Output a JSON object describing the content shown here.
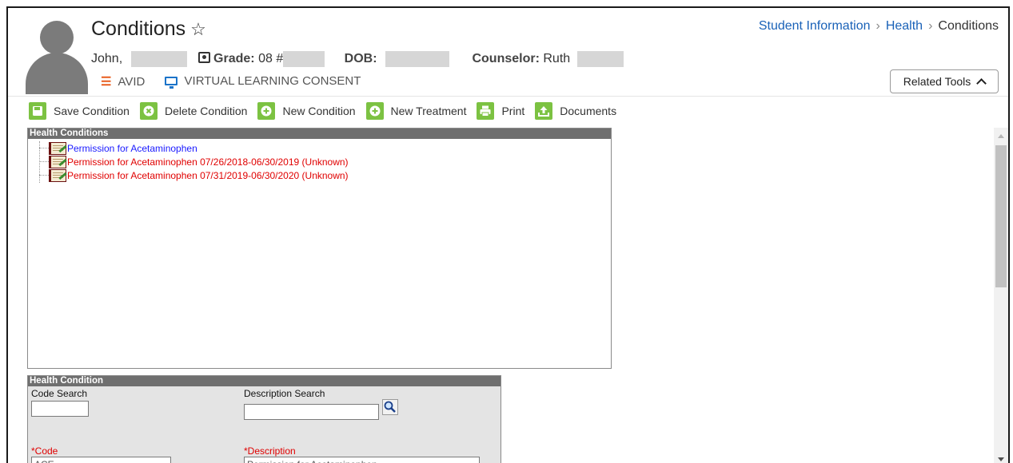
{
  "header": {
    "title": "Conditions",
    "student_name": "John,",
    "grade_label": "Grade:",
    "grade_value": "08 #",
    "dob_label": "DOB:",
    "counselor_label": "Counselor:",
    "counselor_value": "Ruth",
    "flags": [
      {
        "label": "AVID",
        "icon": "checklist-icon",
        "color": "#e85d1f"
      },
      {
        "label": "VIRTUAL LEARNING CONSENT",
        "icon": "monitor-icon",
        "color": "#1a73c9"
      }
    ]
  },
  "breadcrumb": {
    "items": [
      "Student Information",
      "Health",
      "Conditions"
    ]
  },
  "related_tools": {
    "label": "Related Tools"
  },
  "toolbar": {
    "buttons": [
      {
        "label": "Save Condition",
        "icon": "save-icon"
      },
      {
        "label": "Delete Condition",
        "icon": "delete-icon"
      },
      {
        "label": "New Condition",
        "icon": "plus-icon"
      },
      {
        "label": "New Treatment",
        "icon": "plus-icon"
      },
      {
        "label": "Print",
        "icon": "printer-icon"
      },
      {
        "label": "Documents",
        "icon": "upload-icon"
      }
    ]
  },
  "health_conditions": {
    "heading": "Health Conditions",
    "items": [
      {
        "label": "Permission for Acetaminophen",
        "color": "#1a1aff"
      },
      {
        "label": "Permission for Acetaminophen 07/26/2018-06/30/2019 (Unknown)",
        "color": "#e00000"
      },
      {
        "label": "Permission for Acetaminophen 07/31/2019-06/30/2020 (Unknown)",
        "color": "#e00000"
      }
    ]
  },
  "health_condition": {
    "heading": "Health Condition",
    "code_search_label": "Code Search",
    "code_search_value": "",
    "description_search_label": "Description Search",
    "description_search_value": "",
    "code_label": "*Code",
    "code_value": "ACE",
    "description_label": "*Description",
    "description_value": "Permission for Acetaminophen"
  },
  "colors": {
    "accent_green": "#7cc242",
    "link_blue": "#1a62b8",
    "required_red": "#e00000"
  }
}
